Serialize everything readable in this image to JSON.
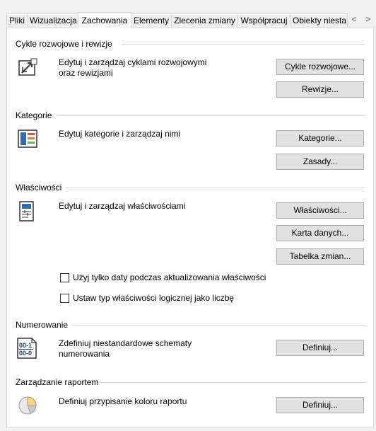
{
  "tabs": [
    {
      "label": "Pliki",
      "active": false
    },
    {
      "label": "Wizualizacja",
      "active": false
    },
    {
      "label": "Zachowania",
      "active": true
    },
    {
      "label": "Elementy",
      "active": false
    },
    {
      "label": "Zlecenia zmiany",
      "active": false
    },
    {
      "label": "Współpracuj",
      "active": false
    },
    {
      "label": "Obiekty niesta",
      "active": false
    }
  ],
  "tab_scroll": {
    "left": "<",
    "right": ">"
  },
  "sections": {
    "lifecycle": {
      "title": "Cykle rozwojowe i rewizje",
      "icon": "lifecycle-icon",
      "description_line1": "Edytuj i zarządzaj cyklami rozwojowymi",
      "description_line2": "oraz rewizjami",
      "buttons": {
        "lifecycles": "Cykle rozwojowe...",
        "revisions": "Rewizje..."
      }
    },
    "categories": {
      "title": "Kategorie",
      "icon": "categories-icon",
      "description": "Edytuj kategorie i zarządzaj nimi",
      "buttons": {
        "categories": "Kategorie...",
        "rules": "Zasady..."
      }
    },
    "properties": {
      "title": "Właściwości",
      "icon": "properties-icon",
      "description": "Edytuj i zarządzaj właściwościami",
      "buttons": {
        "properties": "Właściwości...",
        "datasheet": "Karta danych...",
        "change_table": "Tabelka zmian..."
      },
      "checkboxes": [
        {
          "label": "Użyj tylko daty podczas aktualizowania właściwości",
          "checked": false
        },
        {
          "label": "Ustaw typ właściwości logicznej jako liczbę",
          "checked": false
        }
      ]
    },
    "numbering": {
      "title": "Numerowanie",
      "icon": "numbering-icon",
      "icon_text_top": "00-1",
      "icon_text_bottom": "00-0",
      "description_line1": "Zdefiniuj niestandardowe schematy",
      "description_line2": "numerowania",
      "buttons": {
        "define": "Definiuj..."
      }
    },
    "reports": {
      "title": "Zarządzanie raportem",
      "icon": "report-color-icon",
      "description": "Definiuj przypisanie koloru raportu",
      "buttons": {
        "define": "Definiuj..."
      }
    }
  },
  "colors": {
    "panel_bg": "#ffffff",
    "window_bg": "#f0f0f0",
    "button_bg": "#e1e1e1",
    "button_border": "#adadad"
  }
}
